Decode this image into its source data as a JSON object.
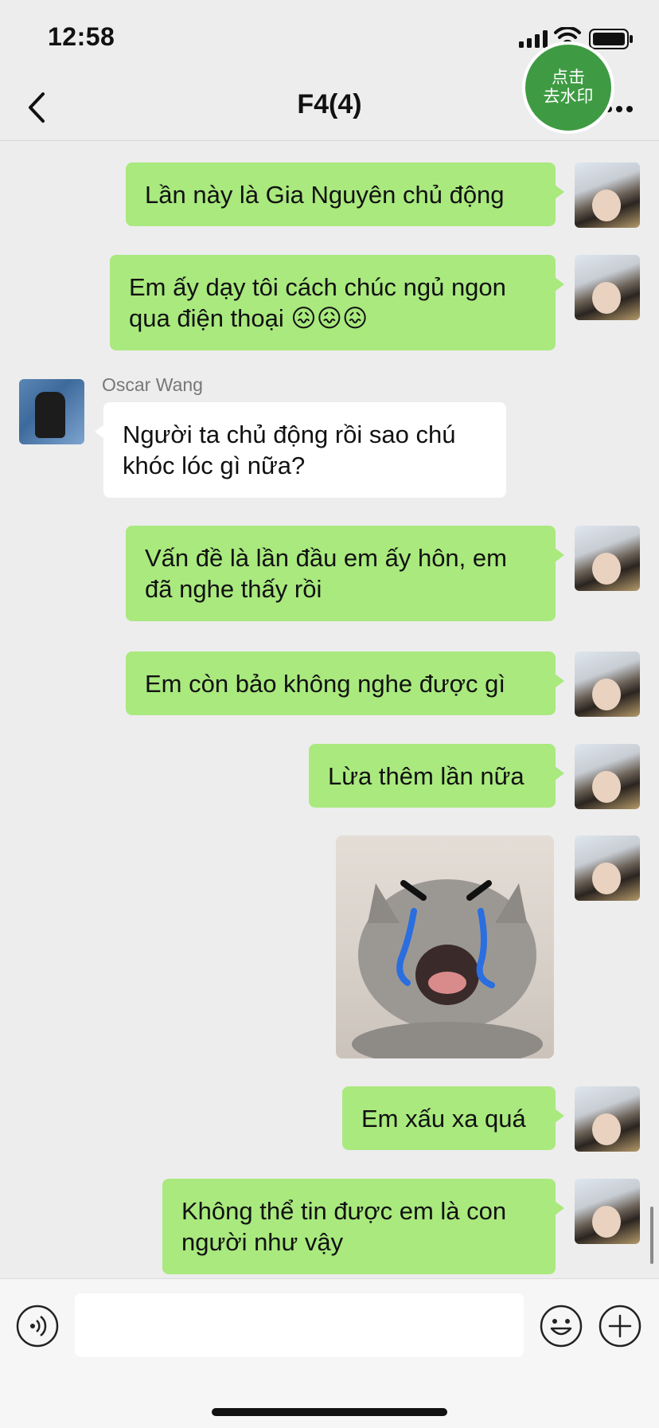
{
  "status_bar": {
    "time": "12:58"
  },
  "header": {
    "title": "F4(4)"
  },
  "watermark_badge": {
    "line1": "点击",
    "line2": "去水印"
  },
  "messages": [
    {
      "side": "right",
      "text": "Lần này là Gia Nguyên chủ động"
    },
    {
      "side": "right",
      "text": "Em ấy dạy tôi cách chúc ngủ ngon qua điện thoại",
      "emoji": "😖😖😖"
    },
    {
      "side": "left",
      "sender": "Oscar Wang",
      "text": "Người ta chủ động rồi sao chú khóc lóc gì nữa?"
    },
    {
      "side": "right",
      "text": "Vấn đề là lần đầu em ấy hôn, em đã nghe thấy rồi"
    },
    {
      "side": "right",
      "text": "Em còn bảo không nghe được gì"
    },
    {
      "side": "right",
      "text": "Lừa thêm lần nữa"
    },
    {
      "side": "right",
      "type": "sticker",
      "description": "crying-cat-sticker"
    },
    {
      "side": "right",
      "text": "Em xấu xa quá"
    },
    {
      "side": "right",
      "text": "Không thể tin được em là con người như vậy"
    }
  ],
  "icons": {
    "back": "chevron-left-icon",
    "more": "more-dots-icon",
    "voice": "voice-input-icon",
    "emoji": "emoji-icon",
    "add": "plus-circle-icon"
  },
  "colors": {
    "my_bubble": "#A9E97E",
    "their_bubble": "#FFFFFF",
    "background": "#EDEDED",
    "badge": "#3E9B43"
  }
}
